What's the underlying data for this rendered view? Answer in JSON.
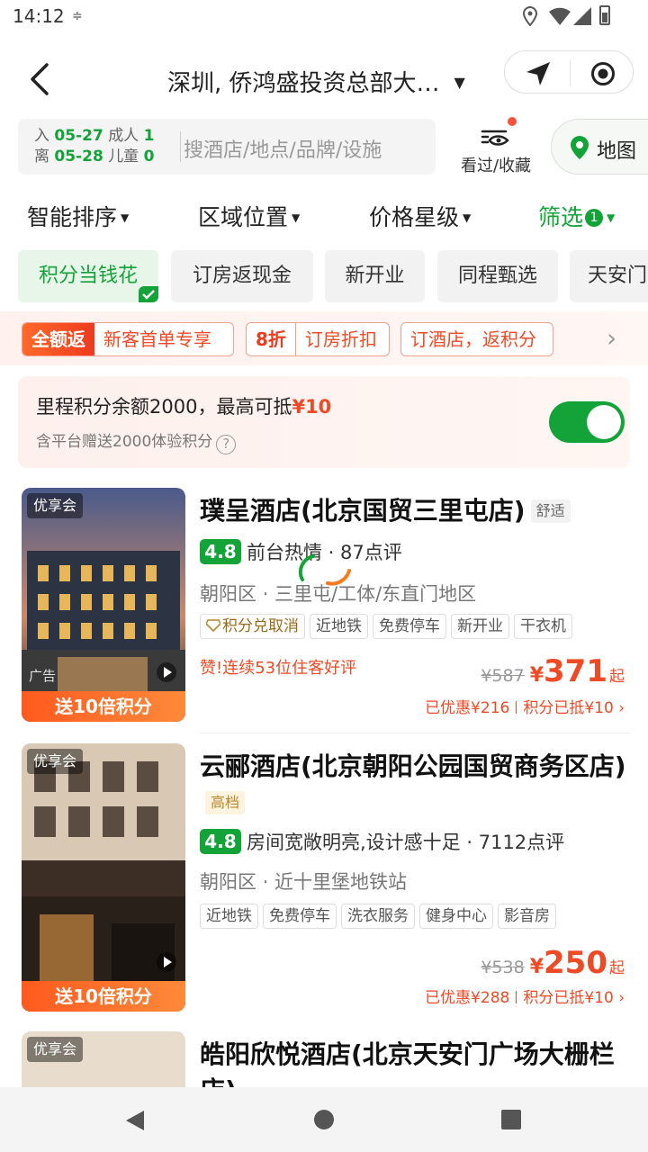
{
  "status_bar": {
    "time": "14:12",
    "sim_icon": "≑"
  },
  "header": {
    "location": "深圳, 侨鸿盛投资总部大…",
    "locate_button_icon": "navigation-arrow-icon",
    "target_button_icon": "target-icon"
  },
  "search": {
    "checkin_label": "入",
    "checkin_date": "05-27",
    "adults_label": "成人",
    "adults_count": "1",
    "checkout_label": "离",
    "checkout_date": "05-28",
    "children_label": "儿童",
    "children_count": "0",
    "placeholder": "搜酒店/地点/品牌/设施",
    "seen_label": "看过/收藏",
    "map_label": "地图"
  },
  "sort_bar": {
    "smart_sort": "智能排序",
    "area": "区域位置",
    "price_star": "价格星级",
    "filter": "筛选",
    "filter_count": "1"
  },
  "chips": [
    "积分当钱花",
    "订房返现金",
    "新开业",
    "同程甄选",
    "天安门"
  ],
  "promo": {
    "tag1_lead": "全额返",
    "tag1_text": "新客首单专享",
    "tag2_lead": "8折",
    "tag2_text": "订房折扣",
    "tag3_text": "订酒店，返积分"
  },
  "points_card": {
    "line1_prefix": "里程积分余额2000，最高可抵",
    "line1_amount": "¥10",
    "line2": "含平台赠送2000体验积分",
    "toggle_on": true
  },
  "hotels": [
    {
      "badge": "优享会",
      "ad_label": "广告",
      "bonus": "送10倍积分",
      "name": "璞呈酒店(北京国贸三里屯店)",
      "tier": "舒适",
      "score": "4.8",
      "highlight": "前台热情",
      "reviews": "87点评",
      "area": "朝阳区 · 三里屯/工体/东直门地区",
      "tag_points": "积分兑取消",
      "tags": [
        "近地铁",
        "免费停车",
        "新开业",
        "干衣机"
      ],
      "praise": "赞!连续53位住客好评",
      "old_price": "¥587",
      "currency": "¥",
      "price": "371",
      "price_suffix": "起",
      "discount": "已优惠¥216",
      "points_discount": "积分已抵¥10"
    },
    {
      "badge": "优享会",
      "bonus": "送10倍积分",
      "name": "云郦酒店(北京朝阳公园国贸商务区店)",
      "tier": "高档",
      "score": "4.8",
      "highlight": "房间宽敞明亮,设计感十足",
      "reviews": "7112点评",
      "area": "朝阳区 · 近十里堡地铁站",
      "tags": [
        "近地铁",
        "免费停车",
        "洗衣服务",
        "健身中心",
        "影音房"
      ],
      "old_price": "¥538",
      "currency": "¥",
      "price": "250",
      "price_suffix": "起",
      "discount": "已优惠¥288",
      "points_discount": "积分已抵¥10"
    },
    {
      "badge": "优享会",
      "name": "皓阳欣悦酒店(北京天安门广场大栅栏店)"
    }
  ],
  "colors": {
    "brand_green": "#13a338",
    "accent_orange": "#ee4a26"
  }
}
